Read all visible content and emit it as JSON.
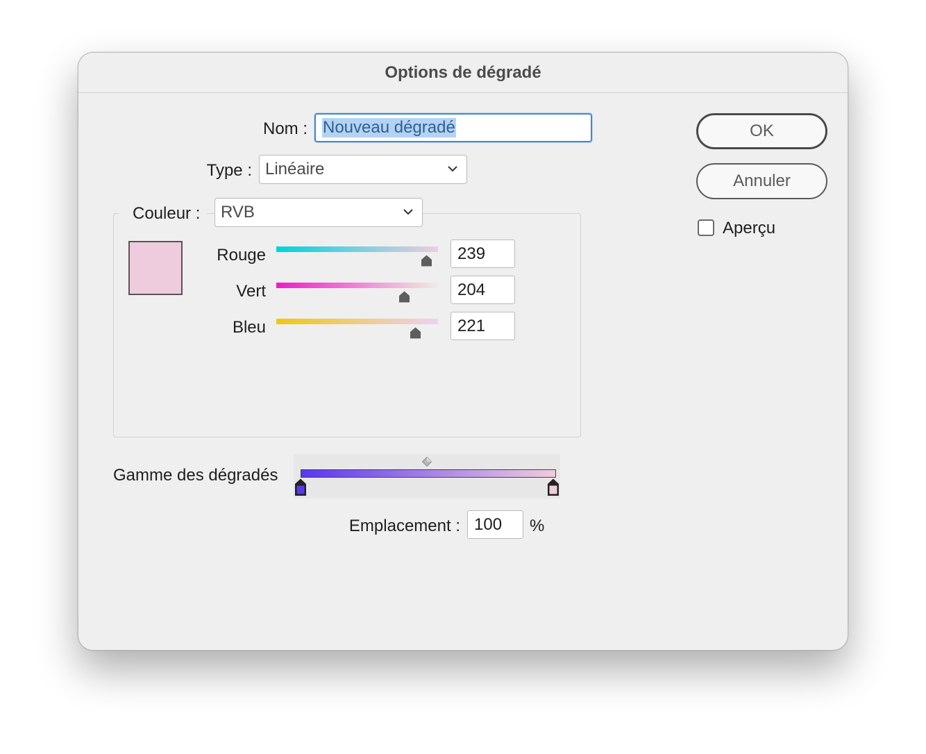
{
  "dialog": {
    "title": "Options de dégradé"
  },
  "name": {
    "label": "Nom :",
    "value": "Nouveau dégradé"
  },
  "type": {
    "label": "Type :",
    "selected": "Linéaire"
  },
  "color": {
    "label": "Couleur :",
    "mode": "RVB",
    "swatch": "#efccdd",
    "sliders": [
      {
        "label": "Rouge",
        "value": "239",
        "fraction": 0.937
      },
      {
        "label": "Vert",
        "value": "204",
        "fraction": 0.8
      },
      {
        "label": "Bleu",
        "value": "221",
        "fraction": 0.867
      }
    ]
  },
  "gradient": {
    "label": "Gamme des dégradés",
    "start_color": "#5a37ee",
    "end_color": "#efccdd"
  },
  "location": {
    "label": "Emplacement :",
    "value": "100",
    "unit": "%"
  },
  "buttons": {
    "ok": "OK",
    "cancel": "Annuler"
  },
  "preview": {
    "label": "Aperçu",
    "checked": false
  }
}
